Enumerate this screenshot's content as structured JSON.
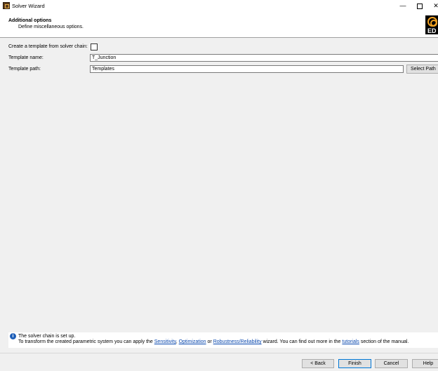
{
  "window": {
    "title": "Solver Wizard",
    "minimize_glyph": "—",
    "close_glyph": "✕"
  },
  "header": {
    "title": "Additional options",
    "subtitle": "Define miscellaneous options.",
    "logo_text": "ED"
  },
  "form": {
    "create_template_label": "Create a template from solver chain:",
    "create_template_checked": false,
    "template_name_label": "Template name:",
    "template_name_value": "T_Junction",
    "template_path_label": "Template path:",
    "template_path_value": "Templates",
    "select_path_button": "Select Path"
  },
  "info": {
    "icon": "i",
    "line1": "The solver chain is set up.",
    "line2_prefix": "To transform the created parametric system you can apply the",
    "link_sensitivity": "Sensitivity",
    "sep1": ",",
    "link_optimization": "Optimization",
    "sep2": "or",
    "link_robustness": "Robustness/Reliability",
    "line2_mid": "wizard. You can find out more in the",
    "link_tutorials": "tutorials",
    "line2_suffix": "section of the manual."
  },
  "buttons": {
    "back": "< Back",
    "finish": "Finish",
    "cancel": "Cancel",
    "help": "Help"
  },
  "colors": {
    "accent": "#0078d7",
    "link": "#0645ad",
    "logo_orange": "#f0a020"
  }
}
